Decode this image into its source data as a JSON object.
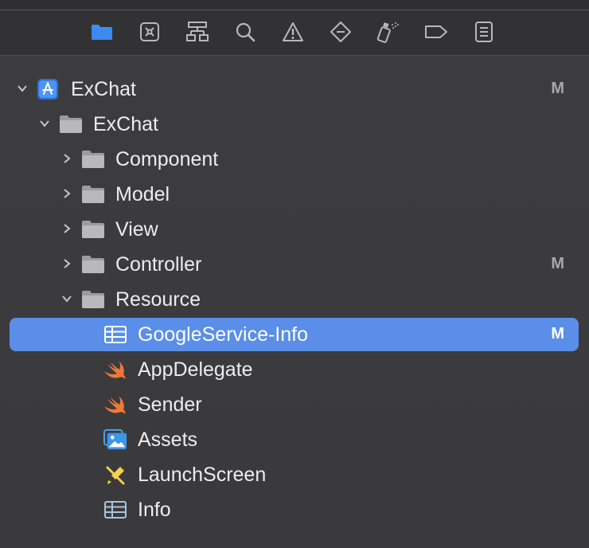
{
  "toolbar": {
    "icons": [
      {
        "name": "folder-icon",
        "color": "#3d8ef7"
      },
      {
        "name": "source-control-icon",
        "color": "#b8b8ba"
      },
      {
        "name": "hierarchy-icon",
        "color": "#b8b8ba"
      },
      {
        "name": "search-icon",
        "color": "#b8b8ba"
      },
      {
        "name": "warning-icon",
        "color": "#b8b8ba"
      },
      {
        "name": "test-diamond-icon",
        "color": "#b8b8ba"
      },
      {
        "name": "debug-spray-icon",
        "color": "#b8b8ba"
      },
      {
        "name": "breakpoint-icon",
        "color": "#b8b8ba"
      },
      {
        "name": "report-icon",
        "color": "#b8b8ba"
      }
    ]
  },
  "tree": [
    {
      "label": "ExChat",
      "icon": "xcode-project-icon",
      "status": "M",
      "expanded": true
    },
    {
      "label": "ExChat",
      "icon": "folder-icon",
      "status": "",
      "expanded": true
    },
    {
      "label": "Component",
      "icon": "folder-icon",
      "status": "",
      "expanded": false
    },
    {
      "label": "Model",
      "icon": "folder-icon",
      "status": "",
      "expanded": false
    },
    {
      "label": "View",
      "icon": "folder-icon",
      "status": "",
      "expanded": false
    },
    {
      "label": "Controller",
      "icon": "folder-icon",
      "status": "M",
      "expanded": false
    },
    {
      "label": "Resource",
      "icon": "folder-icon",
      "status": "",
      "expanded": true
    },
    {
      "label": "GoogleService-Info",
      "icon": "plist-table-icon",
      "status": "M",
      "selected": true
    },
    {
      "label": "AppDelegate",
      "icon": "swift-icon",
      "status": ""
    },
    {
      "label": "Sender",
      "icon": "swift-icon",
      "status": ""
    },
    {
      "label": "Assets",
      "icon": "asset-catalog-icon",
      "status": ""
    },
    {
      "label": "LaunchScreen",
      "icon": "storyboard-icon",
      "status": ""
    },
    {
      "label": "Info",
      "icon": "plist-table-icon",
      "status": ""
    }
  ],
  "colors": {
    "selection": "#5a8ee8",
    "swift": "#f07838",
    "accent": "#3d8ef7"
  }
}
